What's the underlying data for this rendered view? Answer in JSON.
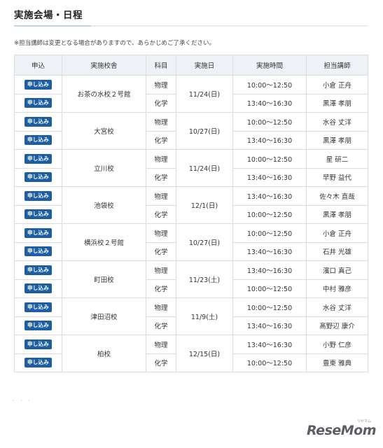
{
  "page": {
    "title": "実施会場・日程",
    "note": "※担当講師は変更となる場合がありますので、あらかじめご了承ください。"
  },
  "table": {
    "headers": [
      "申込",
      "実施校舎",
      "科目",
      "実施日",
      "実施時間",
      "担当講師"
    ],
    "apply_label": "申し込み",
    "venues": [
      {
        "name": "お茶の水校２号館",
        "date": "11/24(日)",
        "rows": [
          {
            "subject": "物理",
            "time": "10:00〜12:50",
            "teacher": "小倉 正舟"
          },
          {
            "subject": "化学",
            "time": "13:40〜16:30",
            "teacher": "黒澤 孝朋"
          }
        ]
      },
      {
        "name": "大宮校",
        "date": "10/27(日)",
        "rows": [
          {
            "subject": "物理",
            "time": "10:00〜12:50",
            "teacher": "水谷 丈洋"
          },
          {
            "subject": "化学",
            "time": "13:40〜16:30",
            "teacher": "黒澤 孝朋"
          }
        ]
      },
      {
        "name": "立川校",
        "date": "11/24(日)",
        "rows": [
          {
            "subject": "物理",
            "time": "10:00〜12:50",
            "teacher": "星 研二"
          },
          {
            "subject": "化学",
            "time": "13:40〜16:30",
            "teacher": "早野 益代"
          }
        ]
      },
      {
        "name": "池袋校",
        "date": "12/1(日)",
        "rows": [
          {
            "subject": "物理",
            "time": "13:40〜16:30",
            "teacher": "佐々木 直哉"
          },
          {
            "subject": "化学",
            "time": "10:00〜12:50",
            "teacher": "黒澤 孝朋"
          }
        ]
      },
      {
        "name": "横浜校２号館",
        "date": "10/27(日)",
        "rows": [
          {
            "subject": "物理",
            "time": "10:00〜12:50",
            "teacher": "小倉 正舟"
          },
          {
            "subject": "化学",
            "time": "13:40〜16:30",
            "teacher": "石井 光雄"
          }
        ]
      },
      {
        "name": "町田校",
        "date": "11/23(土)",
        "rows": [
          {
            "subject": "物理",
            "time": "13:40〜16:30",
            "teacher": "濱口 真己"
          },
          {
            "subject": "化学",
            "time": "10:00〜12:50",
            "teacher": "中村 雅彦"
          }
        ]
      },
      {
        "name": "津田沼校",
        "date": "11/9(土)",
        "rows": [
          {
            "subject": "物理",
            "time": "10:00〜12:50",
            "teacher": "水谷 丈洋"
          },
          {
            "subject": "化学",
            "time": "13:40〜16:30",
            "teacher": "髙野辺 康介"
          }
        ]
      },
      {
        "name": "柏校",
        "date": "12/15(日)",
        "rows": [
          {
            "subject": "物理",
            "time": "13:40〜16:30",
            "teacher": "小野 仁彦"
          },
          {
            "subject": "化学",
            "time": "10:00〜12:50",
            "teacher": "豊東 雅典"
          }
        ]
      }
    ]
  },
  "watermark": {
    "logo_text": "ReseMom",
    "ruby_text": "リセマム"
  },
  "colors": {
    "apply_button": "#1c5ea1",
    "header_bg": "#eef1f5",
    "border": "#dcdcdc"
  }
}
